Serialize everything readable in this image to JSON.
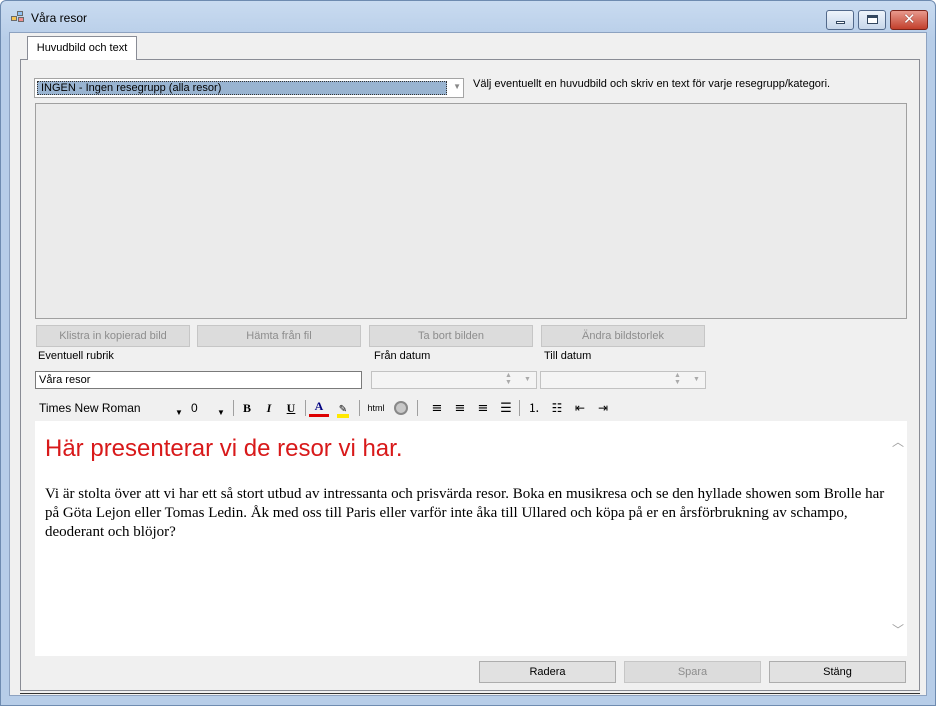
{
  "window": {
    "title": "Våra resor"
  },
  "tabs": [
    {
      "label": "Huvudbild och text"
    }
  ],
  "group_select": {
    "value": "INGEN - Ingen resegrupp (alla resor)"
  },
  "hint": "Välj eventuellt en huvudbild och skriv en text för varje resegrupp/kategori.",
  "image_buttons": {
    "paste": "Klistra in kopierad bild",
    "from_file": "Hämta från fil",
    "remove": "Ta bort bilden",
    "resize": "Ändra bildstorlek"
  },
  "fields": {
    "heading_label": "Eventuell rubrik",
    "heading_value": "Våra resor",
    "from_date_label": "Från datum",
    "to_date_label": "Till datum"
  },
  "toolbar": {
    "font": "Times New Roman",
    "size": "0",
    "bold": "B",
    "italic": "I",
    "underline": "U",
    "font_color": "A",
    "html": "html"
  },
  "editor": {
    "heading": "Här presenterar vi de resor vi har.",
    "body": "Vi är stolta över att vi har ett så stort utbud av intressanta och prisvärda resor. Boka en musikresa och se den hyllade showen som Brolle har på Göta Lejon eller Tomas Ledin. Åk med oss till Paris eller varför inte åka till Ullared och köpa på er en årsförbrukning av schampo, deoderant och blöjor?"
  },
  "footer": {
    "delete": "Radera",
    "save": "Spara",
    "close": "Stäng"
  },
  "colors": {
    "heading_red": "#d8191a",
    "selection": "#99b4d1"
  }
}
